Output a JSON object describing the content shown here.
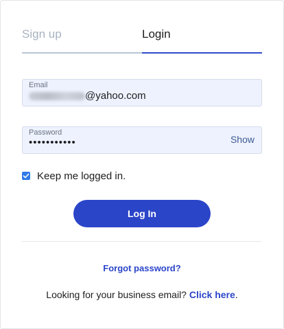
{
  "tabs": {
    "signup_label": "Sign up",
    "login_label": "Login"
  },
  "email_field": {
    "label": "Email",
    "value_suffix": "@yahoo.com"
  },
  "password_field": {
    "label": "Password",
    "value_masked": "•••••••••••",
    "show_label": "Show"
  },
  "keep_logged_in": {
    "label": "Keep me logged in.",
    "checked": true
  },
  "login_button": {
    "label": "Log In"
  },
  "forgot_password": {
    "label": "Forgot password?"
  },
  "business": {
    "prefix": "Looking for your business email? ",
    "link_label": "Click here",
    "suffix": "."
  },
  "colors": {
    "accent": "#2b45c9",
    "field_bg": "#eef2ff",
    "checkbox": "#2f7be8",
    "inactive_tab": "#a8b3c2"
  }
}
